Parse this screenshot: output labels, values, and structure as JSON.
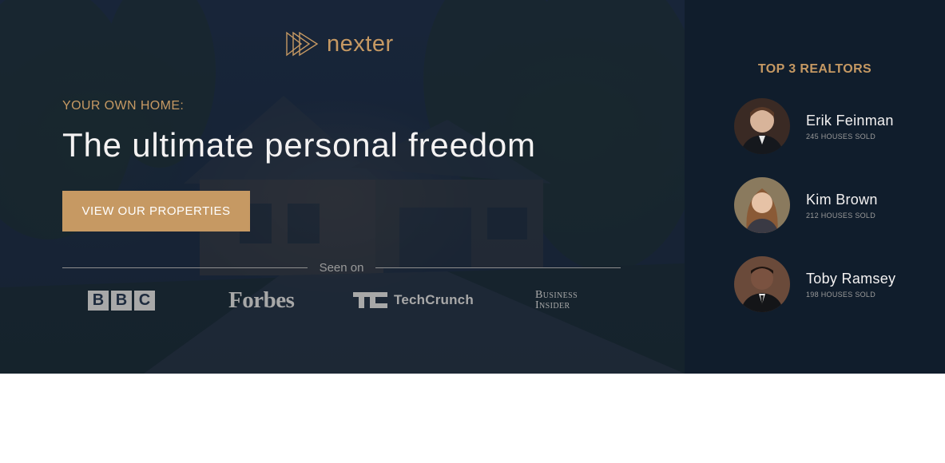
{
  "brand": {
    "name": "nexter",
    "icon": "play-triangles-icon"
  },
  "hero": {
    "eyebrow": "YOUR OWN HOME:",
    "title": "The ultimate personal freedom",
    "cta_label": "VIEW OUR PROPERTIES",
    "seen_on_label": "Seen on",
    "logos": {
      "bbc": [
        "B",
        "B",
        "C"
      ],
      "forbes": "Forbes",
      "techcrunch": "TechCrunch",
      "business_insider": [
        "Business",
        "Insider"
      ]
    }
  },
  "realtors": {
    "title": "TOP 3 REALTORS",
    "items": [
      {
        "name": "Erik Feinman",
        "sold": "245 HOUSES SOLD"
      },
      {
        "name": "Kim Brown",
        "sold": "212 HOUSES SOLD"
      },
      {
        "name": "Toby Ramsey",
        "sold": "198 HOUSES SOLD"
      }
    ]
  },
  "colors": {
    "accent": "#c69963",
    "dark_navy": "#101d2c",
    "light_text": "#f4f2f2",
    "muted_text": "#9a9a9a"
  }
}
